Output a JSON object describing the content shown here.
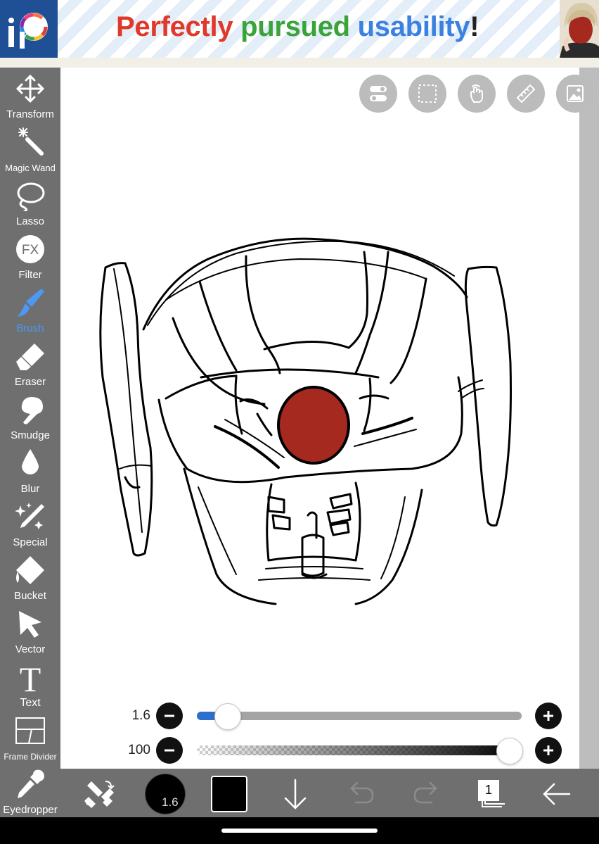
{
  "ad": {
    "words": [
      {
        "text": "Perfectly",
        "color": "#e0382a"
      },
      {
        "text": "pursued",
        "color": "#3aa33a"
      },
      {
        "text": "usability",
        "color": "#3b82e0"
      },
      {
        "text": "!",
        "color": "#222222"
      }
    ],
    "logo_icon": "ibispaint-logo-icon",
    "portrait": "character-portrait"
  },
  "toolbar": {
    "items": [
      {
        "id": "transform",
        "label": "Transform",
        "icon": "transform-icon",
        "active": false
      },
      {
        "id": "magic-wand",
        "label": "Magic Wand",
        "icon": "magic-wand-icon",
        "active": false
      },
      {
        "id": "lasso",
        "label": "Lasso",
        "icon": "lasso-icon",
        "active": false
      },
      {
        "id": "filter",
        "label": "Filter",
        "icon": "fx-icon",
        "active": false
      },
      {
        "id": "brush",
        "label": "Brush",
        "icon": "brush-icon",
        "active": true
      },
      {
        "id": "eraser",
        "label": "Eraser",
        "icon": "eraser-icon",
        "active": false
      },
      {
        "id": "smudge",
        "label": "Smudge",
        "icon": "smudge-icon",
        "active": false
      },
      {
        "id": "blur",
        "label": "Blur",
        "icon": "blur-drop-icon",
        "active": false
      },
      {
        "id": "special",
        "label": "Special",
        "icon": "special-pen-icon",
        "active": false
      },
      {
        "id": "bucket",
        "label": "Bucket",
        "icon": "bucket-icon",
        "active": false
      },
      {
        "id": "vector",
        "label": "Vector",
        "icon": "vector-arrow-icon",
        "active": false
      },
      {
        "id": "text",
        "label": "Text",
        "icon": "text-icon",
        "active": false
      },
      {
        "id": "frame-divider",
        "label": "Frame Divider",
        "icon": "frame-divider-icon",
        "active": false
      },
      {
        "id": "eyedropper",
        "label": "Eyedropper",
        "icon": "eyedropper-icon",
        "active": false
      }
    ],
    "active_color": "#4c98f5"
  },
  "canvas_buttons": [
    {
      "id": "toggle",
      "icon": "toggle-switch-icon"
    },
    {
      "id": "selection",
      "icon": "selection-marquee-icon"
    },
    {
      "id": "touch",
      "icon": "touch-hand-icon"
    },
    {
      "id": "ruler",
      "icon": "ruler-icon"
    },
    {
      "id": "reference",
      "icon": "reference-image-icon"
    }
  ],
  "sliders": {
    "size": {
      "value_label": "1.6",
      "fraction": 0.06
    },
    "opacity": {
      "value_label": "100",
      "fraction": 1.0
    }
  },
  "bottombar": {
    "brush_size_label": "1.6",
    "color_swatch": "#000000",
    "layer_count": "1",
    "icons": [
      "swap-tools-icon",
      "brush-size-preview",
      "color-swatch",
      "arrow-down-icon",
      "undo-icon",
      "redo-icon",
      "layers-icon",
      "back-arrow-icon"
    ]
  },
  "artwork": {
    "subject": "robot-head-sketch",
    "accent_color": "#a5291f"
  }
}
